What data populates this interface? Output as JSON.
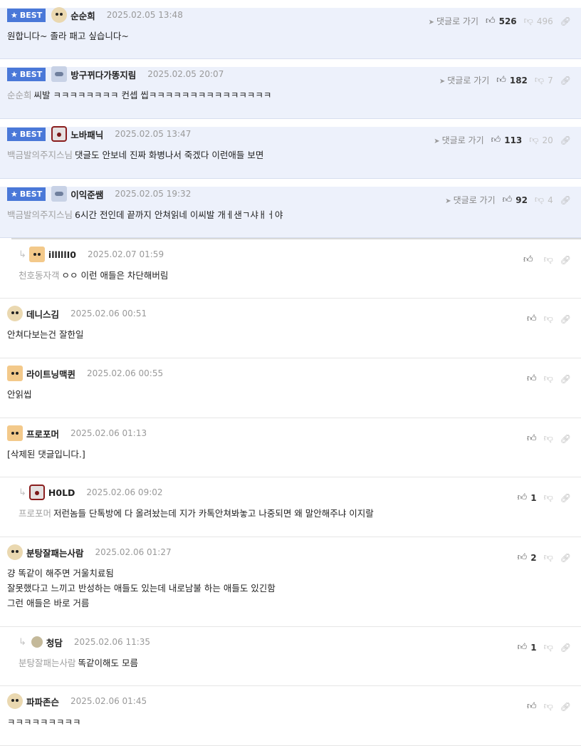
{
  "goto_label": "댓글로 가기",
  "best_label": "BEST",
  "comments": [
    {
      "nick": "순순희",
      "date": "2025.02.05 13:48",
      "up": "526",
      "down": "496",
      "quote": "",
      "text": "원합니다~ 졸라 패고 싶습니다~"
    },
    {
      "nick": "방구뀌다가똥지림",
      "date": "2025.02.05 20:07",
      "up": "182",
      "down": "7",
      "quote": "순순희",
      "text": "씨발 ㅋㅋㅋㅋㅋㅋㅋㅋ 컨셉 씹ㅋㅋㅋㅋㅋㅋㅋㅋㅋㅋㅋㅋㅋㅋㅋ"
    },
    {
      "nick": "노바패닉",
      "date": "2025.02.05 13:47",
      "up": "113",
      "down": "20",
      "quote": "백금발의주지스님",
      "text": "댓글도 안보네 진짜 화병나서 죽겠다 이런애들 보면"
    },
    {
      "nick": "이익준쌤",
      "date": "2025.02.05 19:32",
      "up": "92",
      "down": "4",
      "quote": "백금발의주지스님",
      "text": "6시간 전인데 끝까지 안쳐읽네 이씨발 개ㅔ샌ㄱ샤ㅐㅓ야"
    },
    {
      "nick": "illlllI0",
      "date": "2025.02.07 01:59",
      "up": "",
      "down": "",
      "quote": "천호동자객",
      "text": "ㅇㅇ 이런 애들은 차단해버림"
    },
    {
      "nick": "데니스김",
      "date": "2025.02.06 00:51",
      "up": "",
      "down": "",
      "quote": "",
      "text": "안쳐다보는건 잘한일"
    },
    {
      "nick": "라이트닝맥퀸",
      "date": "2025.02.06 00:55",
      "up": "",
      "down": "",
      "quote": "",
      "text": "안읽씹"
    },
    {
      "nick": "프로포머",
      "date": "2025.02.06 01:13",
      "up": "",
      "down": "",
      "quote": "",
      "text": "[삭제된 댓글입니다.]"
    },
    {
      "nick": "H0LD",
      "date": "2025.02.06 09:02",
      "up": "1",
      "down": "",
      "quote": "프로포머",
      "text": "저런놈들 단톡방에 다 올려놨는데 지가 카톡안쳐봐놓고 나중되면 왜 말안해주냐 이지랄"
    },
    {
      "nick": "분탕잘패는사람",
      "date": "2025.02.06 01:27",
      "up": "2",
      "down": "",
      "quote": "",
      "text": "걍 똑같이 해주면 거울치료됨",
      "text2": "잘못했다고 느끼고 반성하는 애들도 있는데 내로남불 하는 애들도 있긴함",
      "text3": "그런 애들은 바로 거름"
    },
    {
      "nick": "청담",
      "date": "2025.02.06 11:35",
      "up": "1",
      "down": "",
      "quote": "분탕잘패는사람",
      "text": "똑같이해도 모름"
    },
    {
      "nick": "파파존슨",
      "date": "2025.02.06 01:45",
      "up": "",
      "down": "",
      "quote": "",
      "text": "ㅋㅋㅋㅋㅋㅋㅋㅋㅋ"
    }
  ]
}
